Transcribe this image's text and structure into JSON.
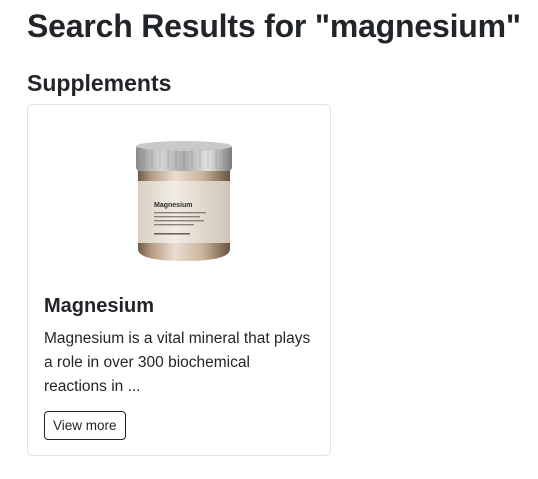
{
  "page": {
    "heading": "Search Results for \"magnesium\""
  },
  "sections": [
    {
      "title": "Supplements",
      "cards": [
        {
          "title": "Magnesium",
          "description": "Magnesium is a vital mineral that plays a role in over 300 biochemical reactions in ...",
          "button_label": "View more",
          "image": {
            "jar_label": "Magnesium",
            "icon": "supplement-jar-image"
          }
        }
      ]
    }
  ]
}
